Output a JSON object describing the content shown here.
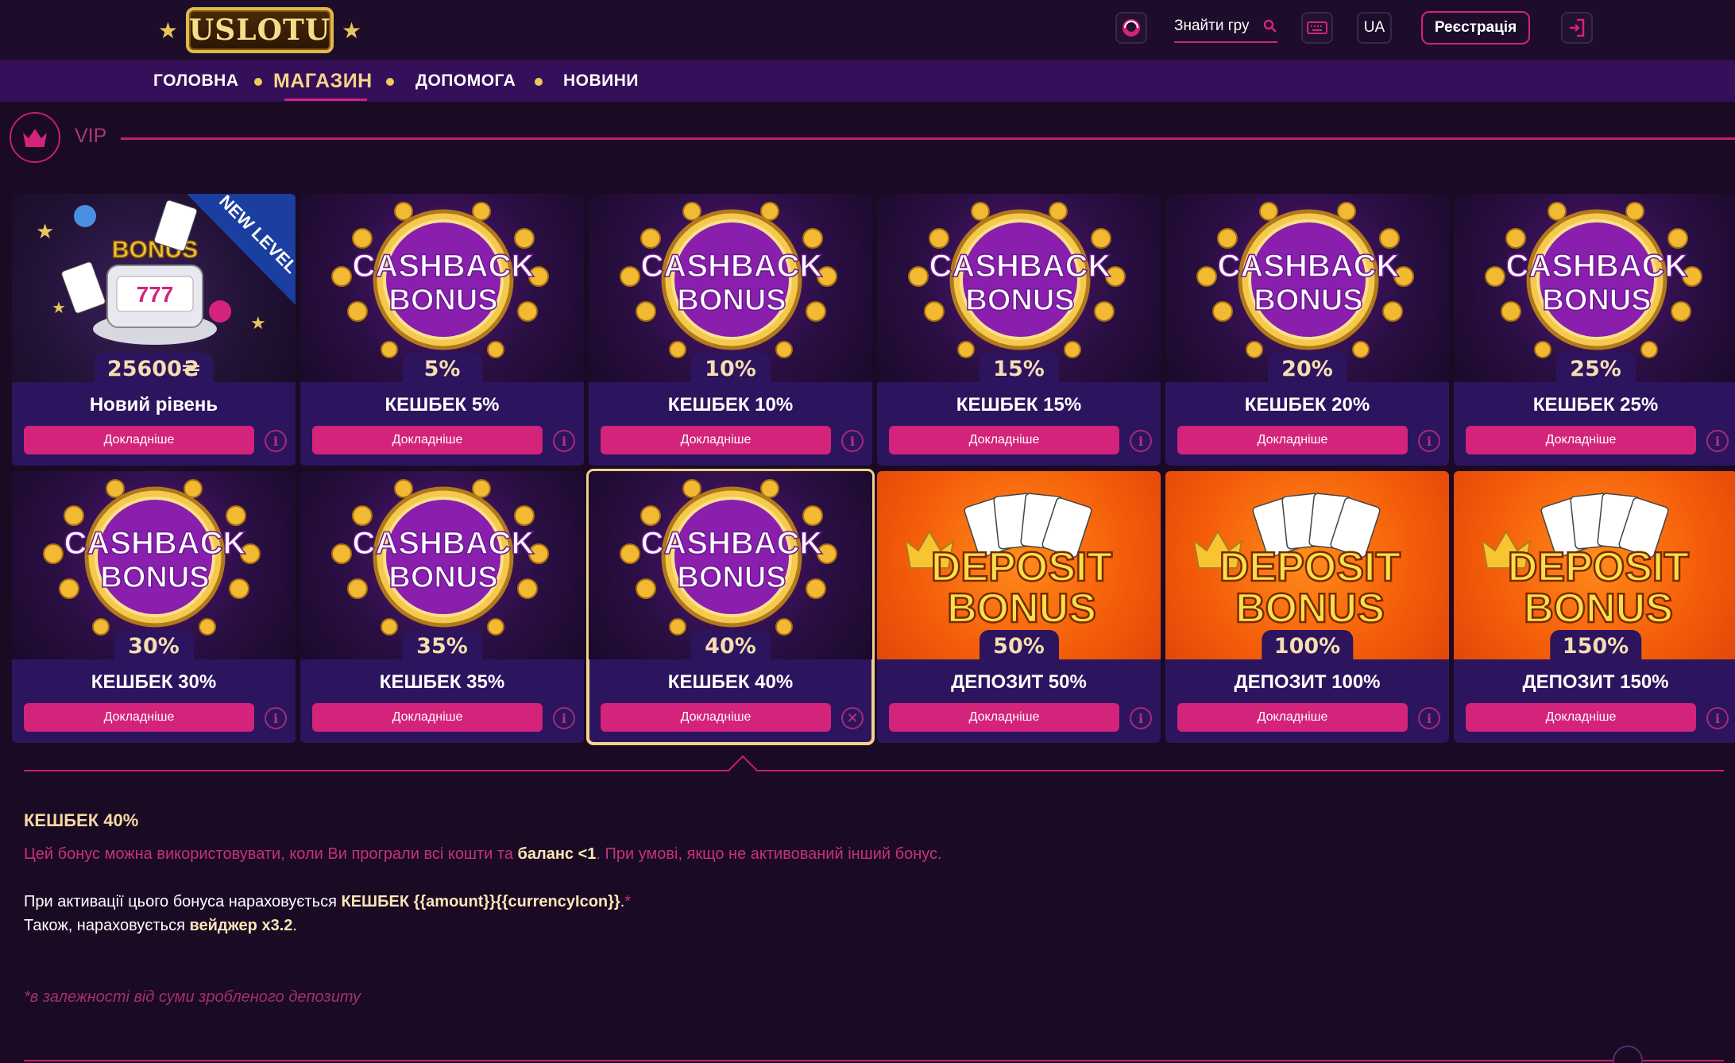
{
  "brand": {
    "logo_text": "USLOTU"
  },
  "header": {
    "search_placeholder": "Знайти гру",
    "lang": "UA",
    "register_label": "Реєстрація"
  },
  "nav": {
    "items": [
      {
        "label": "ГОЛОВНА"
      },
      {
        "label": "МАГАЗИН",
        "active": true
      },
      {
        "label": "ДОПОМОГА"
      },
      {
        "label": "НОВИНИ"
      }
    ]
  },
  "section": {
    "title": "VIP"
  },
  "cards": [
    {
      "badge": "25600₴",
      "title": "Новий рівень",
      "art": "vip",
      "ribbon": "NEW LEVEL",
      "img_text": "BONUS"
    },
    {
      "badge": "5%",
      "title": "КЕШБЕК 5%",
      "art": "cashback",
      "img_line1": "CASHBACK",
      "img_line2": "BONUS"
    },
    {
      "badge": "10%",
      "title": "КЕШБЕК 10%",
      "art": "cashback",
      "img_line1": "CASHBACK",
      "img_line2": "BONUS"
    },
    {
      "badge": "15%",
      "title": "КЕШБЕК 15%",
      "art": "cashback",
      "img_line1": "CASHBACK",
      "img_line2": "BONUS"
    },
    {
      "badge": "20%",
      "title": "КЕШБЕК 20%",
      "art": "cashback",
      "img_line1": "CASHBACK",
      "img_line2": "BONUS"
    },
    {
      "badge": "25%",
      "title": "КЕШБЕК 25%",
      "art": "cashback",
      "img_line1": "CASHBACK",
      "img_line2": "BONUS"
    },
    {
      "badge": "30%",
      "title": "КЕШБЕК 30%",
      "art": "cashback",
      "img_line1": "CASHBACK",
      "img_line2": "BONUS"
    },
    {
      "badge": "35%",
      "title": "КЕШБЕК 35%",
      "art": "cashback",
      "img_line1": "CASHBACK",
      "img_line2": "BONUS"
    },
    {
      "badge": "40%",
      "title": "КЕШБЕК 40%",
      "art": "cashback",
      "img_line1": "CASHBACK",
      "img_line2": "BONUS",
      "selected": true
    },
    {
      "badge": "50%",
      "title": "ДЕПОЗИТ 50%",
      "art": "deposit",
      "img_line1": "DEPOSIT",
      "img_line2": "BONUS"
    },
    {
      "badge": "100%",
      "title": "ДЕПОЗИТ 100%",
      "art": "deposit",
      "img_line1": "DEPOSIT",
      "img_line2": "BONUS"
    },
    {
      "badge": "150%",
      "title": "ДЕПОЗИТ 150%",
      "art": "deposit",
      "img_line1": "DEPOSIT",
      "img_line2": "BONUS"
    }
  ],
  "card_button_label": "Докладніше",
  "details": {
    "title": "КЕШБЕК 40%",
    "p1_before": "Цей бонус можна використовувати, коли Ви програли всі кошти та ",
    "p1_strong": "баланс <1",
    "p1_after": ". При умові, якщо не активований інший бонус.",
    "p2_before": "При активації цього бонуса нараховується ",
    "p2_strong": "КЕШБЕК {{amount}}{{currencyIcon}}",
    "p2_after": ".",
    "p2_star": "*",
    "p3_before": "Також, нараховується ",
    "p3_strong": "вейджер x3.2",
    "p3_after": ".",
    "note": "*в залежності від суми зробленого депозиту"
  },
  "colors": {
    "accent": "#d4237a",
    "background": "#1a0a24",
    "nav": "#350f5a",
    "card": "#2c155e",
    "gold": "#f3d18a"
  }
}
